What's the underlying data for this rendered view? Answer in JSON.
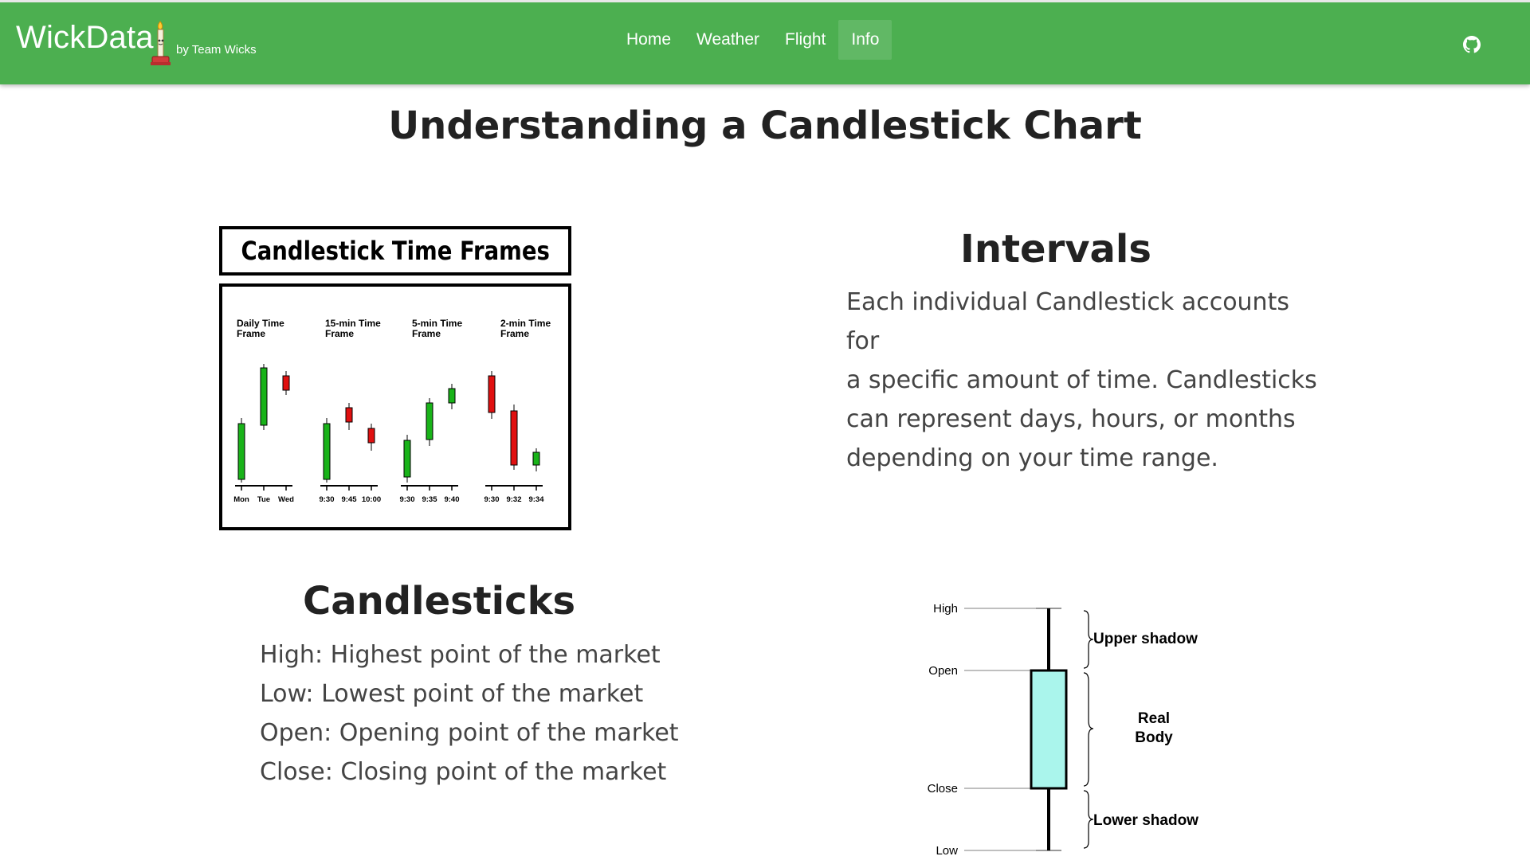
{
  "nav": {
    "brand": "WickData",
    "byline": "by Team Wicks",
    "links": [
      "Home",
      "Weather",
      "Flight",
      "Info"
    ],
    "active": "Info",
    "github_icon": "github-icon"
  },
  "page_title": "Understanding a Candlestick Chart",
  "time_frames": {
    "title": "Candlestick Time Frames",
    "panels": [
      {
        "label_line1": "Daily Time",
        "label_line2": "Frame",
        "ticks": [
          "Mon",
          "Tue",
          "Wed"
        ]
      },
      {
        "label_line1": "15-min Time",
        "label_line2": "Frame",
        "ticks": [
          "9:30",
          "9:45",
          "10:00"
        ]
      },
      {
        "label_line1": "5-min Time",
        "label_line2": "Frame",
        "ticks": [
          "9:30",
          "9:35",
          "9:40"
        ]
      },
      {
        "label_line1": "2-min Time",
        "label_line2": "Frame",
        "ticks": [
          "9:30",
          "9:32",
          "9:34"
        ]
      }
    ],
    "colors": {
      "up": "#19b319",
      "down": "#e01010"
    }
  },
  "intervals": {
    "title": "Intervals",
    "lines": [
      "Each individual Candlestick accounts for",
      "a specific amount of time. Candlesticks",
      "can represent days, hours, or months",
      "depending on your time range."
    ]
  },
  "candlesticks": {
    "title": "Candlesticks",
    "items": [
      "High: Highest point of the market",
      "Low: Lowest point of the market",
      "Open: Opening point of the market",
      "Close: Closing point of the market"
    ]
  },
  "anatomy": {
    "levels": [
      "High",
      "Open",
      "Close",
      "Low"
    ],
    "parts": [
      "Upper shadow",
      "Real",
      "Body",
      "Lower shadow"
    ],
    "body_color": "#aaf5ec"
  }
}
